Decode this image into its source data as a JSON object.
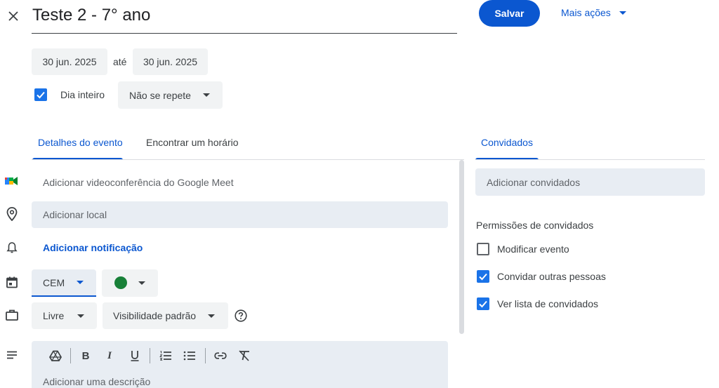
{
  "header": {
    "title": "Teste 2 - 7° ano",
    "save_label": "Salvar",
    "more_actions_label": "Mais ações"
  },
  "dates": {
    "start": "30 jun. 2025",
    "separator": "até",
    "end": "30 jun. 2025"
  },
  "options": {
    "all_day_label": "Dia inteiro",
    "all_day_checked": true,
    "repeat_value": "Não se repete"
  },
  "tabs": {
    "details": "Detalhes do evento",
    "find_time": "Encontrar um horário",
    "guests": "Convidados"
  },
  "details": {
    "meet_label": "Adicionar videoconferência do Google Meet",
    "location_placeholder": "Adicionar local",
    "notification_label": "Adicionar notificação",
    "calendar_value": "CEM",
    "event_color": "#188038",
    "availability_value": "Livre",
    "visibility_value": "Visibilidade padrão",
    "description_placeholder": "Adicionar uma descrição"
  },
  "guests": {
    "add_placeholder": "Adicionar convidados",
    "permissions_title": "Permissões de convidados",
    "permissions": [
      {
        "label": "Modificar evento",
        "checked": false
      },
      {
        "label": "Convidar outras pessoas",
        "checked": true
      },
      {
        "label": "Ver lista de convidados",
        "checked": true
      }
    ]
  },
  "colors": {
    "accent": "#1a73e8",
    "save_button": "#0b57d0",
    "field_background": "#e8edf3"
  },
  "icons": [
    "close-icon",
    "google-meet-icon",
    "location-pin-icon",
    "bell-icon",
    "calendar-icon",
    "briefcase-icon",
    "help-icon",
    "description-lines-icon",
    "drive-icon",
    "bold-icon",
    "italic-icon",
    "underline-icon",
    "numbered-list-icon",
    "bulleted-list-icon",
    "link-icon",
    "clear-format-icon"
  ]
}
